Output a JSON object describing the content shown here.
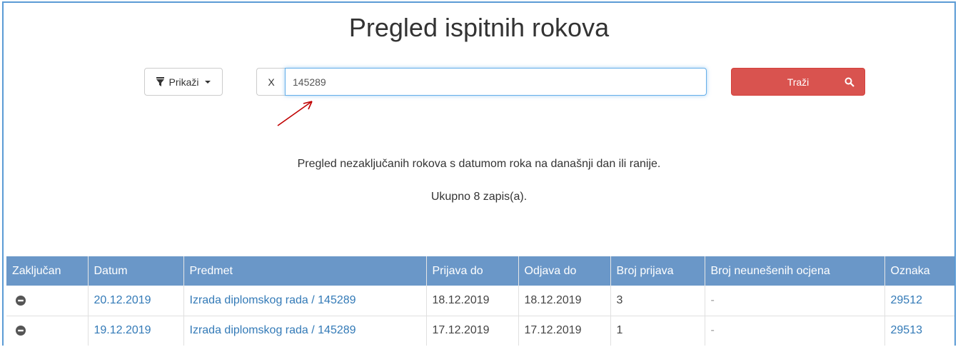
{
  "page": {
    "title": "Pregled ispitnih rokova"
  },
  "toolbar": {
    "show_label": "Prikaži",
    "clear_label": "X",
    "search_value": "145289",
    "search_label": "Traži"
  },
  "info": {
    "description": "Pregled nezaključanih rokova s datumom roka na današnji dan ili ranije.",
    "count": "Ukupno 8 zapis(a)."
  },
  "table": {
    "headers": [
      "Zaključan",
      "Datum",
      "Predmet",
      "Prijava do",
      "Odjava do",
      "Broj prijava",
      "Broj neunešenih ocjena",
      "Oznaka"
    ],
    "rows": [
      {
        "locked": "minus-circle-icon",
        "datum": "20.12.2019",
        "predmet": "Izrada diplomskog rada / 145289",
        "prijava_do": "18.12.2019",
        "odjava_do": "18.12.2019",
        "broj_prijava": "3",
        "broj_neunesenih": "-",
        "oznaka": "29512"
      },
      {
        "locked": "minus-circle-icon",
        "datum": "19.12.2019",
        "predmet": "Izrada diplomskog rada / 145289",
        "prijava_do": "17.12.2019",
        "odjava_do": "17.12.2019",
        "broj_prijava": "1",
        "broj_neunesenih": "-",
        "oznaka": "29513"
      }
    ]
  },
  "colors": {
    "header_bg": "#6a97c8",
    "link": "#337ab7",
    "danger": "#d9534f",
    "frame_border": "#5b9bd5",
    "annotation_arrow": "#c00000"
  }
}
